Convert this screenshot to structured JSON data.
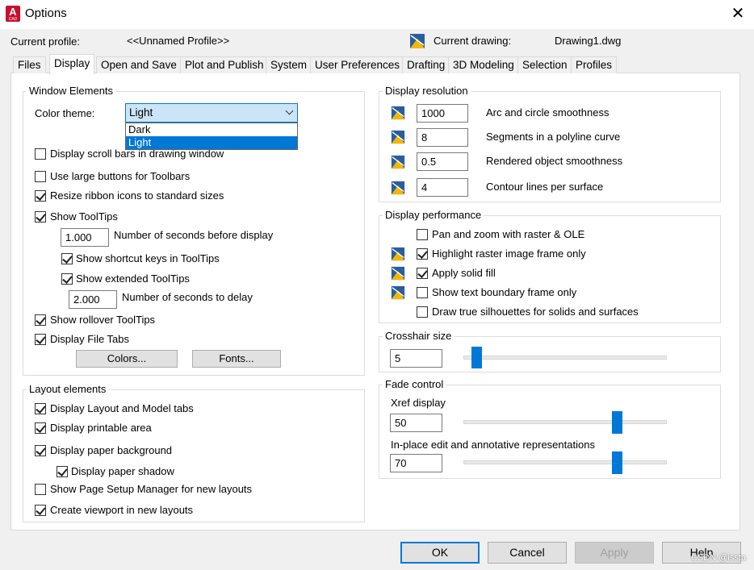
{
  "window": {
    "title": "Options",
    "close_glyph": "✕",
    "app_icon_letter": "A",
    "app_icon_sub": "CAD"
  },
  "profile": {
    "label": "Current profile:",
    "value": "<<Unnamed Profile>>"
  },
  "drawing": {
    "label": "Current drawing:",
    "value": "Drawing1.dwg",
    "icon": "drawing-file-icon"
  },
  "tabs": [
    {
      "label": "Files"
    },
    {
      "label": "Display",
      "active": true
    },
    {
      "label": "Open and Save"
    },
    {
      "label": "Plot and Publish"
    },
    {
      "label": "System"
    },
    {
      "label": "User Preferences"
    },
    {
      "label": "Drafting"
    },
    {
      "label": "3D Modeling"
    },
    {
      "label": "Selection"
    },
    {
      "label": "Profiles"
    }
  ],
  "window_elements": {
    "title": "Window Elements",
    "color_theme_label": "Color theme:",
    "color_theme_value": "Light",
    "color_theme_options": [
      "Dark",
      "Light"
    ],
    "scroll_bars": {
      "label": "Display scroll bars in drawing window",
      "checked": false
    },
    "large_buttons": {
      "label": "Use large buttons for Toolbars",
      "checked": false
    },
    "resize_ribbon": {
      "label": "Resize ribbon icons to standard sizes",
      "checked": true
    },
    "show_tooltips": {
      "label": "Show ToolTips",
      "checked": true
    },
    "seconds_before_display": {
      "value": "1.000",
      "label": "Number of seconds before display"
    },
    "shortcut_keys": {
      "label": "Show shortcut keys in ToolTips",
      "checked": true
    },
    "extended_tooltips": {
      "label": "Show extended ToolTips",
      "checked": true
    },
    "seconds_to_delay": {
      "value": "2.000",
      "label": "Number of seconds to delay"
    },
    "rollover_tooltips": {
      "label": "Show rollover ToolTips",
      "checked": true
    },
    "file_tabs": {
      "label": "Display File Tabs",
      "checked": true
    },
    "colors_button": "Colors...",
    "fonts_button": "Fonts..."
  },
  "layout_elements": {
    "title": "Layout elements",
    "items": [
      {
        "label": "Display Layout and Model tabs",
        "checked": true
      },
      {
        "label": "Display printable area",
        "checked": true
      },
      {
        "label": "Display paper background",
        "checked": true
      },
      {
        "label": "Display paper shadow",
        "checked": true
      },
      {
        "label": "Show Page Setup Manager for new layouts",
        "checked": false
      },
      {
        "label": "Create viewport in new layouts",
        "checked": true
      }
    ]
  },
  "display_resolution": {
    "title": "Display resolution",
    "rows": [
      {
        "value": "1000",
        "label": "Arc and circle smoothness"
      },
      {
        "value": "8",
        "label": "Segments in a polyline curve"
      },
      {
        "value": "0.5",
        "label": "Rendered object smoothness"
      },
      {
        "value": "4",
        "label": "Contour lines per surface"
      }
    ]
  },
  "display_performance": {
    "title": "Display performance",
    "items": [
      {
        "label": "Pan and zoom with raster & OLE",
        "checked": false,
        "icon": false
      },
      {
        "label": "Highlight raster image frame only",
        "checked": true,
        "icon": true
      },
      {
        "label": "Apply solid fill",
        "checked": true,
        "icon": true
      },
      {
        "label": "Show text boundary frame only",
        "checked": false,
        "icon": true
      },
      {
        "label": "Draw true silhouettes for solids and surfaces",
        "checked": false,
        "icon": false
      }
    ]
  },
  "crosshair": {
    "title": "Crosshair size",
    "value": "5",
    "slider_fraction": 0.05
  },
  "fade_control": {
    "title": "Fade control",
    "xref_label": "Xref display",
    "xref_value": "50",
    "xref_slider_fraction": 0.75,
    "inplace_label": "In-place edit and annotative representations",
    "inplace_value": "70",
    "inplace_slider_fraction": 0.75
  },
  "buttons": {
    "ok": "OK",
    "cancel": "Cancel",
    "apply": "Apply",
    "help": "Help"
  },
  "watermark": "CSDN @issta",
  "colors": {
    "accent": "#0078d7",
    "app_icon": "#c8102e"
  }
}
